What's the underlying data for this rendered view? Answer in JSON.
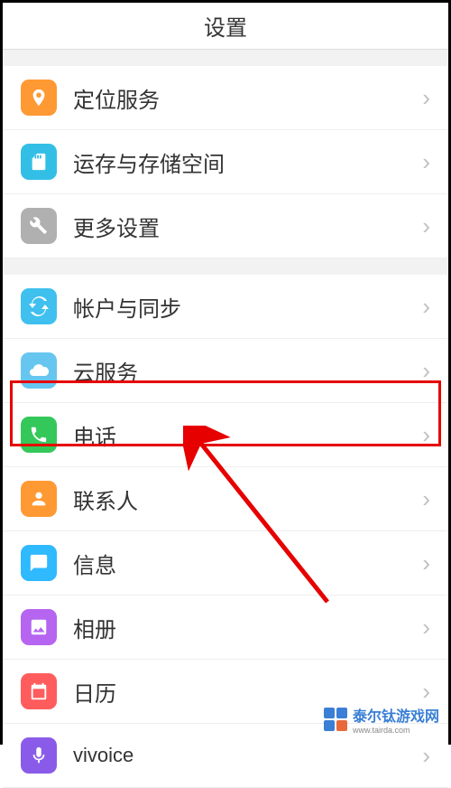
{
  "header": {
    "title": "设置"
  },
  "groups": [
    {
      "items": [
        {
          "key": "location",
          "label": "定位服务",
          "icon": "location-icon",
          "color": "#ff9933"
        },
        {
          "key": "storage",
          "label": "运存与存储空间",
          "icon": "sd-icon",
          "color": "#33bfe5"
        },
        {
          "key": "more",
          "label": "更多设置",
          "icon": "wrench-icon",
          "color": "#b0b0b0"
        }
      ]
    },
    {
      "items": [
        {
          "key": "account",
          "label": "帐户与同步",
          "icon": "sync-icon",
          "color": "#3fc0ee"
        },
        {
          "key": "cloud",
          "label": "云服务",
          "icon": "cloud-icon",
          "color": "#66c6f0"
        },
        {
          "key": "phone",
          "label": "电话",
          "icon": "phone-icon",
          "color": "#34c85a",
          "highlighted": true
        },
        {
          "key": "contacts",
          "label": "联系人",
          "icon": "contact-icon",
          "color": "#ff9933"
        },
        {
          "key": "messages",
          "label": "信息",
          "icon": "message-icon",
          "color": "#2fb9ff"
        },
        {
          "key": "album",
          "label": "相册",
          "icon": "photo-icon",
          "color": "#b565f0"
        },
        {
          "key": "calendar",
          "label": "日历",
          "icon": "calendar-icon",
          "color": "#ff5d5d"
        },
        {
          "key": "vivoice",
          "label": "vivoice",
          "icon": "mic-icon",
          "color": "#8a5be8"
        }
      ]
    }
  ],
  "watermark": {
    "brand": "泰尔钛游戏网",
    "url": "www.tairda.com"
  }
}
